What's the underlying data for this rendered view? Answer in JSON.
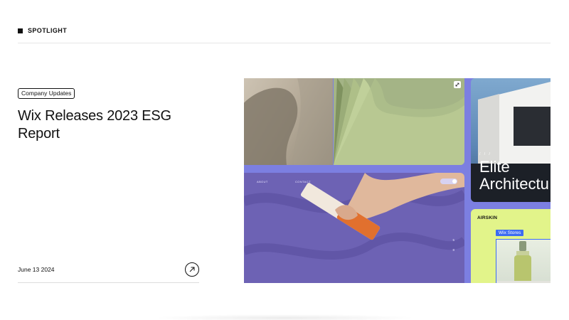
{
  "section": {
    "label": "SPOTLIGHT"
  },
  "article": {
    "tag": "Company Updates",
    "title": "Wix Releases 2023 ESG Report",
    "date": "June 13 2024"
  },
  "icons": {
    "section_marker": "square-bullet-icon",
    "open_article": "arrow-up-right-icon",
    "expand": "expand-icon"
  },
  "collage": {
    "architecture_title_line1": "Elite",
    "architecture_title_line2": "Architectu",
    "architecture_kicker": "/ / /",
    "purple_nav_left": "ABOUT",
    "purple_nav_center": "CONTACT",
    "purple_side_num_1": "5",
    "purple_side_num_2": "8",
    "airskin_brand": "AIRSKIN",
    "stores_badge": "Wix Stores"
  },
  "colors": {
    "collage_bg": "#7c7fe1",
    "lime": "#e2f48a",
    "accent_blue": "#3d6cf1",
    "purple": "#6d62b4",
    "green": "#a4b486"
  }
}
